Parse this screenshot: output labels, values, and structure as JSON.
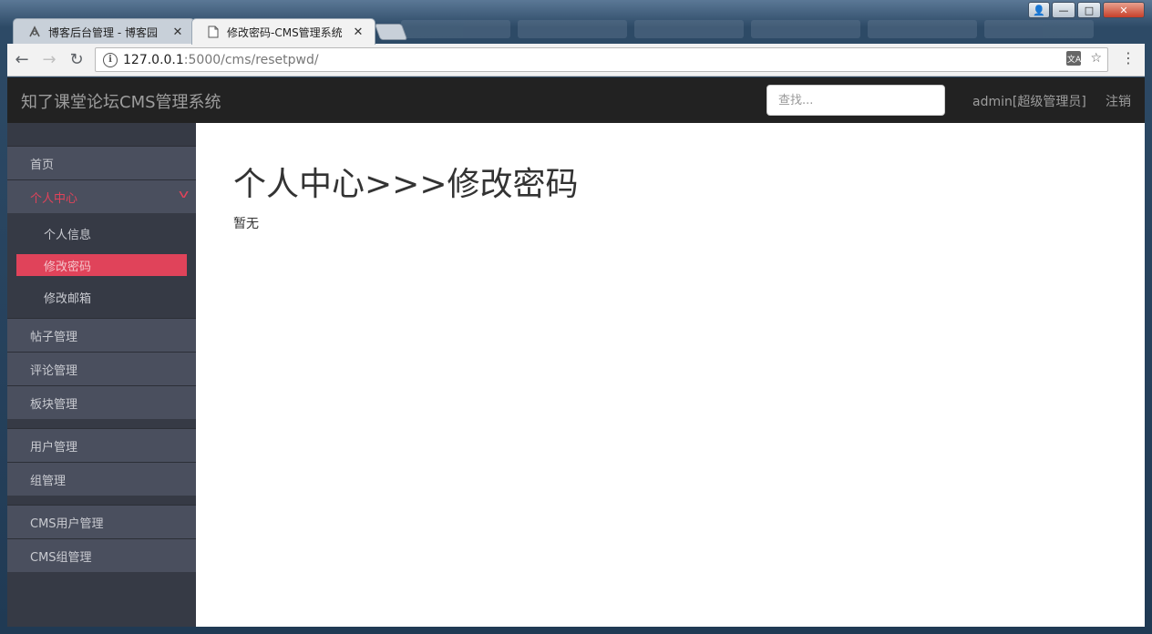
{
  "window": {
    "controls": {
      "user": "👤",
      "minimize": "—",
      "maximize": "□",
      "close": "✕"
    }
  },
  "tabs": [
    {
      "title": "博客后台管理 - 博客园",
      "icon": "blog-logo-icon",
      "close": "✕",
      "active": false
    },
    {
      "title": "修改密码-CMS管理系统",
      "icon": "page-icon",
      "close": "✕",
      "active": true
    }
  ],
  "toolbar": {
    "back": "←",
    "forward": "→",
    "reload": "↻",
    "url_host": "127.0.0.1",
    "url_path": ":5000/cms/resetpwd/",
    "translate": "文A",
    "bookmark": "☆",
    "menu": "⋮"
  },
  "navbar": {
    "brand": "知了课堂论坛CMS管理系统",
    "search_placeholder": "查找...",
    "user": "admin[超级管理员]",
    "logout": "注销"
  },
  "sidebar": {
    "groups": [
      {
        "items": [
          {
            "label": "首页"
          },
          {
            "label": "个人中心",
            "active": true,
            "expanded": true,
            "children": [
              {
                "label": "个人信息"
              },
              {
                "label": "修改密码",
                "selected": true
              },
              {
                "label": "修改邮箱"
              }
            ]
          }
        ]
      },
      {
        "items": [
          {
            "label": "帖子管理"
          },
          {
            "label": "评论管理"
          },
          {
            "label": "板块管理"
          }
        ]
      },
      {
        "items": [
          {
            "label": "用户管理"
          },
          {
            "label": "组管理"
          }
        ]
      },
      {
        "items": [
          {
            "label": "CMS用户管理"
          },
          {
            "label": "CMS组管理"
          }
        ]
      }
    ]
  },
  "main": {
    "title": "个人中心>>>修改密码",
    "body": "暂无"
  },
  "colors": {
    "accent": "#e0435a",
    "navbar_bg": "#222222",
    "sidebar_bg": "#363a45",
    "sidebar_item_bg": "#4a4f5e"
  }
}
